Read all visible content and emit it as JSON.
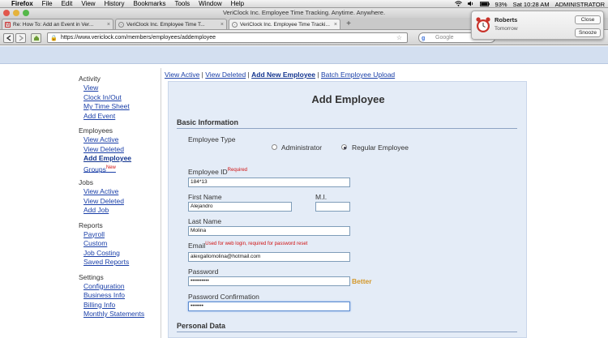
{
  "menubar": {
    "app": "Firefox",
    "items": [
      "File",
      "Edit",
      "View",
      "History",
      "Bookmarks",
      "Tools",
      "Window",
      "Help"
    ],
    "status": {
      "battery": "93%",
      "datetime": "Sat 10:28 AM",
      "user": "ADMINISTRATOR"
    }
  },
  "window": {
    "title": "VeriClock Inc. Employee Time Tracking. Anytime. Anywhere."
  },
  "tabs": [
    {
      "label": "Re: How To: Add an Event in Ver...",
      "icon": "gmail-icon"
    },
    {
      "label": "VeriClock Inc. Employee Time T...",
      "icon": "clock-icon"
    },
    {
      "label": "VeriClock Inc. Employee Time Tracki...",
      "icon": "clock-icon"
    }
  ],
  "browser": {
    "url": "https://www.vericlock.com/members/employees/addemployee",
    "search_placeholder": "Google"
  },
  "notification": {
    "title": "Roberts",
    "subtitle": "Tomorrow",
    "close_label": "Close",
    "snooze_label": "Snooze"
  },
  "sidebar": {
    "sections": [
      {
        "heading": "Activity",
        "items": [
          "View",
          "Clock In/Out",
          "My Time Sheet",
          "Add Event"
        ]
      },
      {
        "heading": "Employees",
        "items": [
          "View Active",
          "View Deleted",
          "Add Employee",
          "Groups"
        ],
        "groups_badge": "New"
      },
      {
        "heading": "Jobs",
        "items": [
          "View Active",
          "View Deleted",
          "Add Job"
        ]
      },
      {
        "heading": "Reports",
        "items": [
          "Payroll",
          "Custom",
          "Job Costing",
          "Saved Reports"
        ]
      },
      {
        "heading": "Settings",
        "items": [
          "Configuration",
          "Business Info",
          "Billing Info",
          "Monthly Statements"
        ]
      }
    ]
  },
  "topnav": {
    "view_active": "View Active",
    "view_deleted": "View Deleted",
    "add_new": "Add New Employee",
    "batch_upload": "Batch Employee Upload"
  },
  "form": {
    "title": "Add Employee",
    "basic_heading": "Basic Information",
    "employee_type_label": "Employee Type",
    "type_options": [
      "Administrator",
      "Regular Employee"
    ],
    "selected_type": "Regular Employee",
    "employee_id_label": "Employee ID",
    "required_note": "Required",
    "employee_id_value": "184*13",
    "first_name_label": "First Name",
    "first_name_value": "Alejandro",
    "mi_label": "M.I.",
    "mi_value": "",
    "last_name_label": "Last Name",
    "last_name_value": "Molina",
    "email_label": "Email",
    "email_note": "Used for web login, required for password reset",
    "email_value": "alexgallomolina@hotmail.com",
    "password_label": "Password",
    "password_value": "••••••••••",
    "password_strength": "Better",
    "confirm_label": "Password Confirmation",
    "confirm_value": "•••••••",
    "personal_heading": "Personal Data"
  }
}
